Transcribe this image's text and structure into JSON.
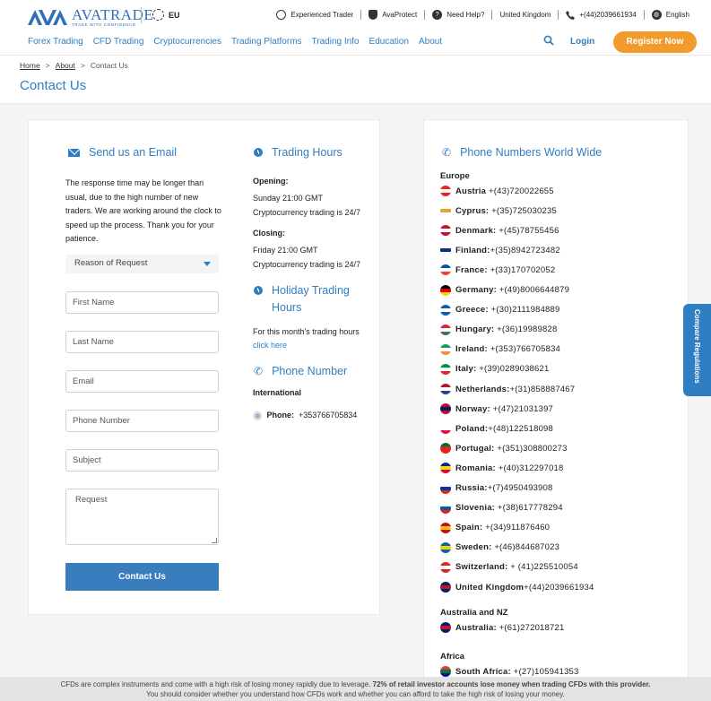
{
  "header": {
    "logo_name": "AVATRADE",
    "logo_tagline": "TRADE WITH CONFIDENCE",
    "region": "EU",
    "utils": [
      {
        "label": "Experienced Trader",
        "icon": "user-icon"
      },
      {
        "label": "AvaProtect",
        "icon": "shield-icon"
      },
      {
        "label": "Need Help?",
        "icon": "help-icon"
      },
      {
        "label": "United Kingdom",
        "icon": ""
      },
      {
        "label": "+(44)2039661934",
        "icon": "phone-icon"
      },
      {
        "label": "English",
        "icon": "globe-icon"
      }
    ]
  },
  "nav": {
    "items": [
      "Forex Trading",
      "CFD Trading",
      "Cryptocurrencies",
      "Trading Platforms",
      "Trading Info",
      "Education",
      "About"
    ],
    "login": "Login",
    "register": "Register Now"
  },
  "breadcrumb": {
    "home": "Home",
    "sep": ">",
    "about": "About",
    "current": "Contact Us"
  },
  "page_title": "Contact Us",
  "email_section": {
    "title": "Send us an Email",
    "message": "The response time may be longer than usual, due to the high number of new traders. We are working around the clock to speed up the process. Thank you for your patience.",
    "reason_select": "Reason of Request",
    "fields": {
      "first_name": "First Name",
      "last_name": "Last Name",
      "email": "Email",
      "phone": "Phone Number",
      "subject": "Subject",
      "request": "Request"
    },
    "submit": "Contact Us"
  },
  "trading_hours": {
    "title": "Trading Hours",
    "opening_label": "Opening:",
    "opening_time": "Sunday 21:00 GMT",
    "opening_crypto": "Cryptocurrency trading is 24/7",
    "closing_label": "Closing:",
    "closing_time": "Friday 21:00 GMT",
    "closing_crypto": "Cryptocurrency trading is 24/7"
  },
  "holiday_hours": {
    "title_line1": "Holiday Trading",
    "title_line2": "Hours",
    "text": "For this month's trading hours",
    "link": "click here"
  },
  "phone_section": {
    "title": "Phone Number",
    "subtitle": "International",
    "label": "Phone:",
    "number": "+353766705834"
  },
  "world_numbers": {
    "title": "Phone Numbers World Wide",
    "regions": [
      {
        "name": "Europe",
        "rows": [
          {
            "country": "Austria",
            "sep": " ",
            "number": "+(43)720022655",
            "flag": [
              "#e5261e",
              "#ffffff",
              "#e5261e"
            ]
          },
          {
            "country": "Cyprus:",
            "sep": " ",
            "number": "+(35)725030235",
            "flag": [
              "#ffffff",
              "#e8a23a",
              "#ffffff"
            ]
          },
          {
            "country": "Denmark:",
            "sep": " ",
            "number": "+(45)78755456",
            "flag": [
              "#c8102e",
              "#ffffff",
              "#c8102e"
            ]
          },
          {
            "country": "Finland:",
            "sep": "",
            "number": "+(35)8942723482",
            "flag": [
              "#ffffff",
              "#003580",
              "#ffffff"
            ]
          },
          {
            "country": "France:",
            "sep": " ",
            "number": "+(33)170702052",
            "flag": [
              "#0055a4",
              "#ffffff",
              "#ef4135"
            ]
          },
          {
            "country": "Germany:",
            "sep": " ",
            "number": "+(49)8006644879",
            "flag": [
              "#000000",
              "#dd0000",
              "#ffce00"
            ]
          },
          {
            "country": "Greece:",
            "sep": " ",
            "number": "+(30)2111984889",
            "flag": [
              "#0d5eaf",
              "#ffffff",
              "#0d5eaf"
            ]
          },
          {
            "country": "Hungary:",
            "sep": " ",
            "number": "+(36)19989828",
            "flag": [
              "#ce2939",
              "#ffffff",
              "#477050"
            ]
          },
          {
            "country": "Ireland:",
            "sep": " ",
            "number": "+(353)766705834",
            "flag": [
              "#169b62",
              "#ffffff",
              "#ff883e"
            ]
          },
          {
            "country": "Italy:",
            "sep": " ",
            "number": "+(39)0289038621",
            "flag": [
              "#009246",
              "#ffffff",
              "#ce2b37"
            ]
          },
          {
            "country": "Netherlands:",
            "sep": "",
            "number": "+(31)858887467",
            "flag": [
              "#ae1c28",
              "#ffffff",
              "#21468b"
            ]
          },
          {
            "country": "Norway:",
            "sep": " ",
            "number": "+(47)21031397",
            "flag": [
              "#ba0c2f",
              "#00205b",
              "#ba0c2f"
            ]
          },
          {
            "country": "Poland:",
            "sep": "",
            "number": "+(48)122518098",
            "flag": [
              "#ffffff",
              "#ffffff",
              "#dc143c"
            ]
          },
          {
            "country": "Portugal:",
            "sep": " ",
            "number": "+(351)308800273",
            "flag": [
              "#046a38",
              "#da291c",
              "#da291c"
            ]
          },
          {
            "country": "Romania:",
            "sep": " ",
            "number": "+(40)312297018",
            "flag": [
              "#002b7f",
              "#fcd116",
              "#ce1126"
            ]
          },
          {
            "country": "Russia:",
            "sep": "",
            "number": "+(7)4950493908",
            "flag": [
              "#ffffff",
              "#0039a6",
              "#d52b1e"
            ]
          },
          {
            "country": "Slovenia:",
            "sep": " ",
            "number": "+(38)617778294",
            "flag": [
              "#ffffff",
              "#005da4",
              "#ed1c24"
            ]
          },
          {
            "country": "Spain:",
            "sep": " ",
            "number": "+(34)911876460",
            "flag": [
              "#c60b1e",
              "#ffc400",
              "#c60b1e"
            ]
          },
          {
            "country": "Sweden:",
            "sep": " ",
            "number": "+(46)844687023",
            "flag": [
              "#006aa7",
              "#fecc00",
              "#006aa7"
            ]
          },
          {
            "country": "Switzerland:",
            "sep": " ",
            "number": "+ (41)225510054",
            "flag": [
              "#da291c",
              "#ffffff",
              "#da291c"
            ]
          },
          {
            "country": "United Kingdom",
            "sep": "",
            "number": "+(44)2039661934",
            "flag": [
              "#012169",
              "#c8102e",
              "#012169"
            ]
          }
        ]
      },
      {
        "name": "Australia and NZ",
        "rows": [
          {
            "country": "Australia:",
            "sep": " ",
            "number": "+(61)272018721",
            "flag": [
              "#012169",
              "#c8102e",
              "#012169"
            ]
          }
        ]
      },
      {
        "name": "Africa",
        "rows": [
          {
            "country": "South Africa:",
            "sep": " ",
            "number": "+(27)105941353",
            "flag": [
              "#e03c31",
              "#007749",
              "#001489"
            ]
          }
        ]
      }
    ]
  },
  "compare_tab": "Compare Regulations",
  "risk_warning": {
    "line1_pre": "CFDs are complex instruments and come with a high risk of losing money rapidly due to leverage.",
    "line1_bold": "72% of retail investor accounts lose money when trading CFDs with this provider.",
    "line2": "You should consider whether you understand how CFDs work and whether you can afford to take the high risk of losing your money."
  },
  "colors": {
    "brand_blue": "#2f7ec2",
    "register_orange": "#f39a2c",
    "button_blue": "#3a7dbf"
  }
}
